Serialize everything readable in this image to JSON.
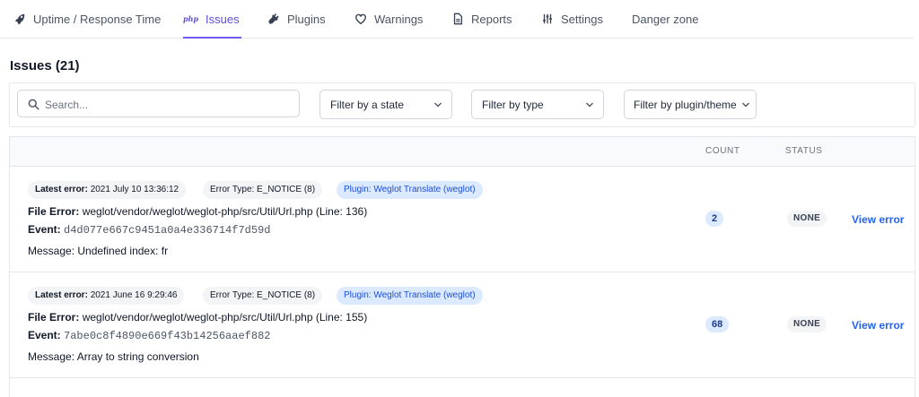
{
  "tabs": [
    {
      "label": "Uptime / Response Time",
      "icon": "rocket-icon"
    },
    {
      "label": "Issues",
      "icon": "php-icon",
      "active": true
    },
    {
      "label": "Plugins",
      "icon": "plug-icon"
    },
    {
      "label": "Warnings",
      "icon": "heart-icon"
    },
    {
      "label": "Reports",
      "icon": "document-icon"
    },
    {
      "label": "Settings",
      "icon": "sliders-icon"
    },
    {
      "label": "Danger zone",
      "icon": null
    }
  ],
  "php_glyph": "php",
  "page_title": "Issues (21)",
  "filters": {
    "search_placeholder": "Search...",
    "state": "Filter by a state",
    "type": "Filter by type",
    "plugin": "Filter by plugin/theme"
  },
  "table": {
    "headers": {
      "count": "COUNT",
      "status": "STATUS"
    },
    "rows": [
      {
        "latest_error_label": "Latest error:",
        "latest_error": "2021 July 10 13:36:12",
        "error_type": "Error Type: E_NOTICE (8)",
        "plugin": "Plugin: Weglot Translate (weglot)",
        "file_error_label": "File Error:",
        "file_error": "weglot/vendor/weglot/weglot-php/src/Util/Url.php (Line: 136)",
        "event_label": "Event:",
        "event": "d4d077e667c9451a0a4e336714f7d59d",
        "message": "Message: Undefined index: fr",
        "count": "2",
        "status": "NONE",
        "action": "View error"
      },
      {
        "latest_error_label": "Latest error:",
        "latest_error": "2021 June 16 9:29:46",
        "error_type": "Error Type: E_NOTICE (8)",
        "plugin": "Plugin: Weglot Translate (weglot)",
        "file_error_label": "File Error:",
        "file_error": "weglot/vendor/weglot/weglot-php/src/Util/Url.php (Line: 155)",
        "event_label": "Event:",
        "event": "7abe0c8f4890e669f43b14256aaef882",
        "message": "Message: Array to string conversion",
        "count": "68",
        "status": "NONE",
        "action": "View error"
      }
    ]
  },
  "colors": {
    "accent": "#6d5ce8",
    "link": "#2563eb",
    "plugin_badge": "#dbeafe"
  }
}
